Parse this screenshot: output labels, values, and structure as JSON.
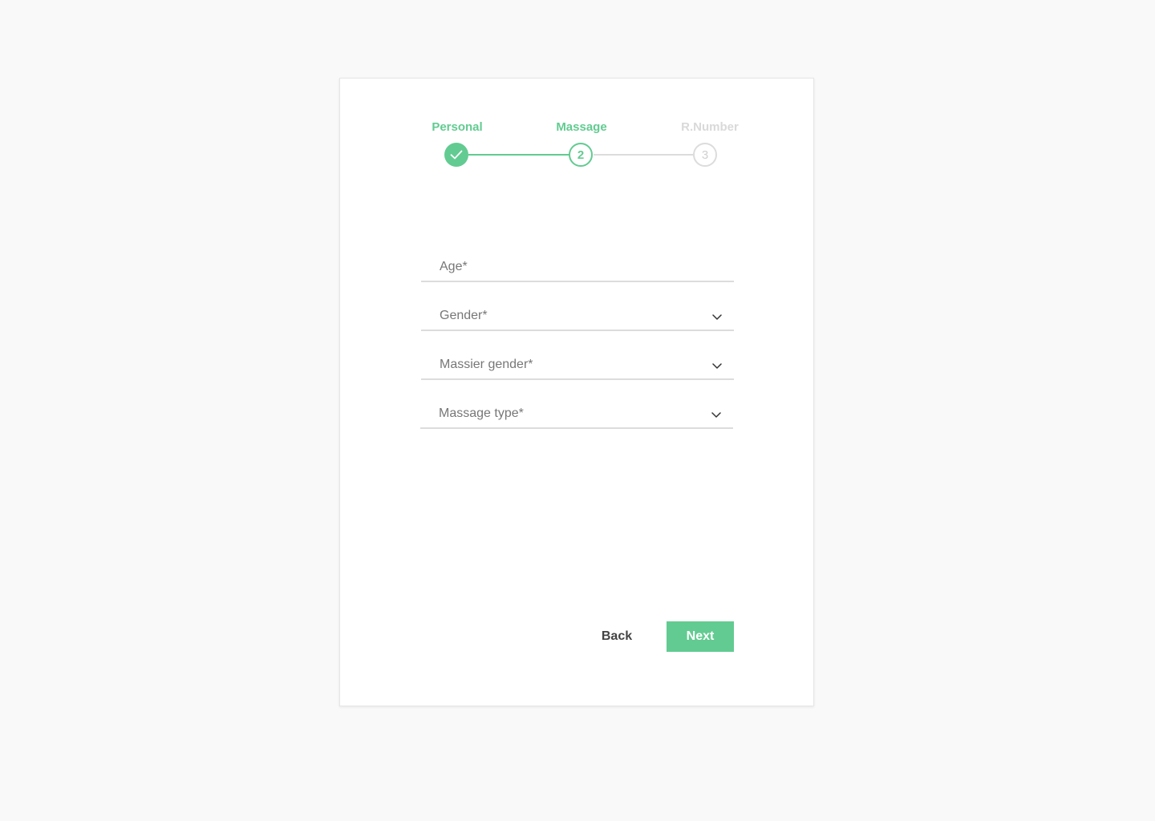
{
  "colors": {
    "accent": "#62cb91",
    "inactive": "#dcdcdc",
    "inactive_text": "#d9d9d9"
  },
  "stepper": {
    "steps": [
      {
        "label": "Personal",
        "status": "completed",
        "icon": "check-icon"
      },
      {
        "label": "Massage",
        "status": "active",
        "number": "2"
      },
      {
        "label": "R.Number",
        "status": "pending",
        "number": "3"
      }
    ]
  },
  "form": {
    "age": {
      "label": "Age*"
    },
    "gender": {
      "label": "Gender*",
      "icon": "chevron-down-icon"
    },
    "massier_gender": {
      "label": "Massier gender*",
      "icon": "chevron-down-icon"
    },
    "massage_type": {
      "label": "Massage type*",
      "icon": "chevron-down-icon"
    }
  },
  "actions": {
    "back_label": "Back",
    "next_label": "Next"
  }
}
